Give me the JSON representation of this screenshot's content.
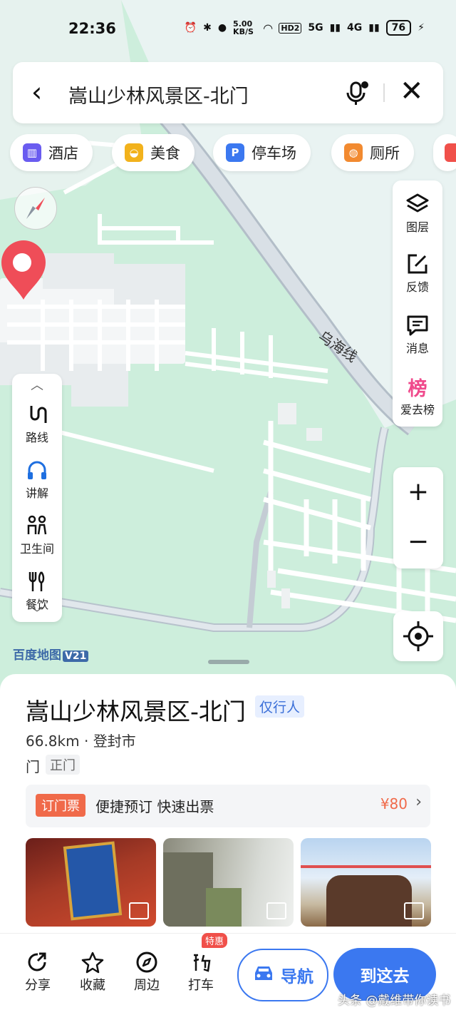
{
  "status_bar": {
    "time": "22:36",
    "speed": "5.00 KB/S",
    "hd": "HD2",
    "net1": "5G",
    "net2": "4G",
    "battery": "76"
  },
  "search": {
    "query": "嵩山少林风景区-北门"
  },
  "chips": [
    {
      "label": "酒店",
      "icon": "hotel-icon",
      "color": "#6a5cf0"
    },
    {
      "label": "美食",
      "icon": "food-icon",
      "color": "#f2b21c"
    },
    {
      "label": "停车场",
      "icon": "parking-icon",
      "color": "#3b78f0"
    },
    {
      "label": "厕所",
      "icon": "toilet-icon",
      "color": "#f28a30"
    }
  ],
  "map": {
    "road_label": "乌海线",
    "brand": "百度地图",
    "version": "V21"
  },
  "right_tools": [
    {
      "label": "图层",
      "icon": "layers-icon"
    },
    {
      "label": "反馈",
      "icon": "feedback-icon"
    },
    {
      "label": "消息",
      "icon": "message-icon"
    },
    {
      "label": "爱去榜",
      "icon": "ranking-icon",
      "glyph": "榜"
    }
  ],
  "left_tools": [
    {
      "label": "路线",
      "icon": "route-icon"
    },
    {
      "label": "讲解",
      "icon": "headphones-icon"
    },
    {
      "label": "卫生间",
      "icon": "restroom-icon"
    },
    {
      "label": "餐饮",
      "icon": "dining-icon"
    }
  ],
  "zoom": {
    "in": "+",
    "out": "−"
  },
  "place": {
    "title": "嵩山少林风景区-北门",
    "pedestrian_tag": "仅行人",
    "distance": "66.8km",
    "city": "登封市",
    "type": "门",
    "type_tag": "正门",
    "ticket": {
      "badge": "订门票",
      "text": "便捷预订 快速出票",
      "price": "¥80"
    }
  },
  "actions": {
    "share": "分享",
    "favorite": "收藏",
    "nearby": "周边",
    "taxi": "打车",
    "taxi_badge": "特惠",
    "navigate": "导航",
    "go": "到这去"
  },
  "watermark": "头条 @戴维带你读书"
}
